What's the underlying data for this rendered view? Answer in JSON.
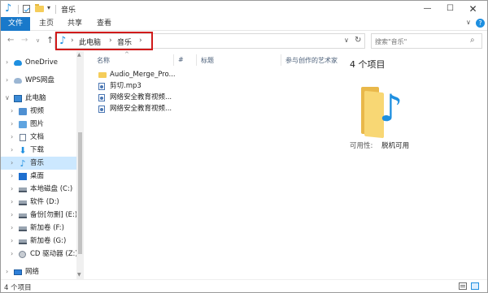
{
  "window": {
    "title": "音乐",
    "minimize_glyph": "—",
    "maximize_glyph": "☐",
    "close_glyph": "✕"
  },
  "ribbon": {
    "tabs": [
      "文件",
      "主页",
      "共享",
      "查看"
    ],
    "help_glyph": "?"
  },
  "navigation": {
    "breadcrumb": [
      "此电脑",
      "音乐"
    ],
    "search_placeholder": "搜索\"音乐\""
  },
  "sidebar": {
    "items": [
      {
        "label": "OneDrive",
        "icon": "onedrive-cloud-icon"
      },
      {
        "label": "WPS网盘",
        "icon": "wps-cloud-icon"
      },
      {
        "label": "此电脑",
        "icon": "computer-icon",
        "expanded": true
      },
      {
        "label": "视频",
        "icon": "videos-folder-icon"
      },
      {
        "label": "图片",
        "icon": "pictures-folder-icon"
      },
      {
        "label": "文档",
        "icon": "documents-icon"
      },
      {
        "label": "下载",
        "icon": "downloads-arrow-icon"
      },
      {
        "label": "音乐",
        "icon": "music-note-icon",
        "selected": true
      },
      {
        "label": "桌面",
        "icon": "desktop-icon"
      },
      {
        "label": "本地磁盘 (C:)",
        "icon": "drive-icon"
      },
      {
        "label": "软件 (D:)",
        "icon": "drive-icon"
      },
      {
        "label": "备份[勿删] (E:)",
        "icon": "drive-icon"
      },
      {
        "label": "新加卷 (F:)",
        "icon": "drive-icon"
      },
      {
        "label": "新加卷 (G:)",
        "icon": "drive-icon"
      },
      {
        "label": "CD 驱动器 (Z:)",
        "icon": "cd-drive-icon"
      },
      {
        "label": "网络",
        "icon": "network-icon"
      }
    ]
  },
  "file_list": {
    "columns": [
      "名称",
      "#",
      "标题",
      "参与创作的艺术家"
    ],
    "files": [
      {
        "name": "Audio_Merge_Pro...",
        "type": "folder"
      },
      {
        "name": "剪切.mp3",
        "type": "audio"
      },
      {
        "name": "网络安全教育视频...",
        "type": "audio"
      },
      {
        "name": "网络安全教育视频...",
        "type": "audio"
      }
    ]
  },
  "preview": {
    "title": "4 个项目",
    "availability_label": "可用性:",
    "availability_value": "脱机可用"
  },
  "status_bar": {
    "item_count": "4 个项目"
  }
}
